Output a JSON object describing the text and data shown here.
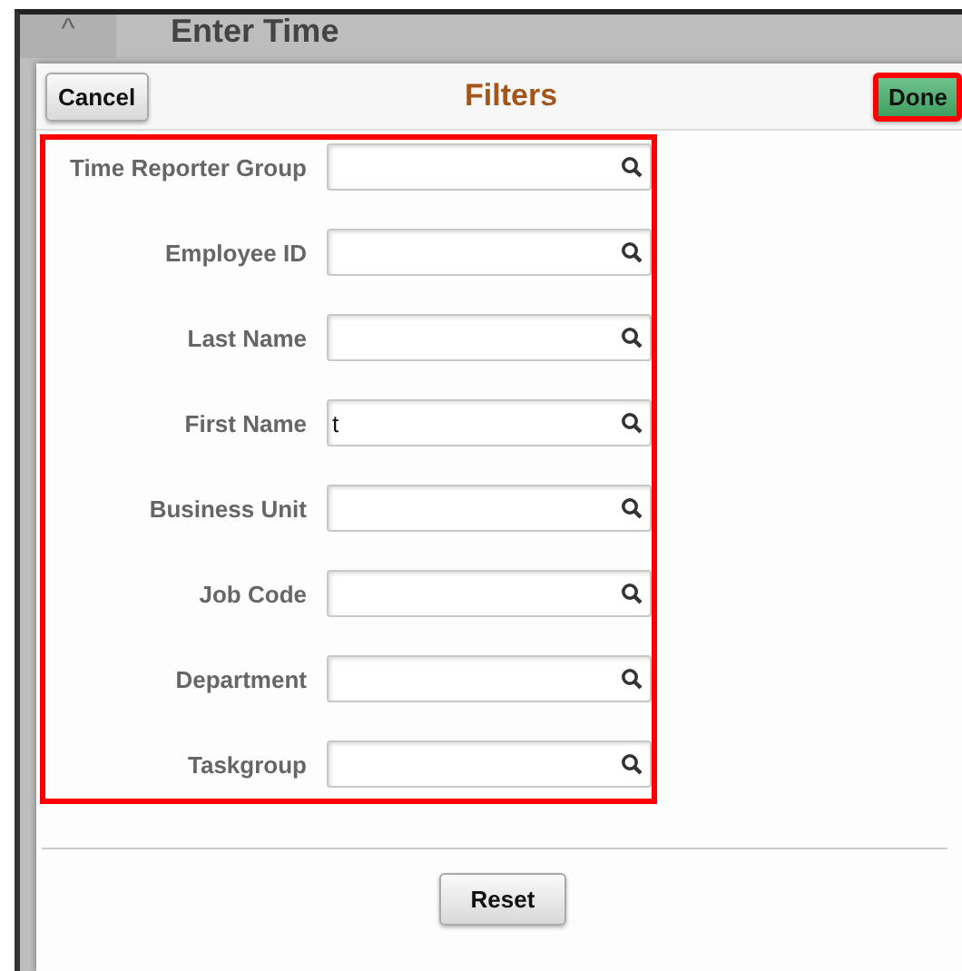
{
  "page": {
    "title": "Enter Time",
    "collapse_icon": "^"
  },
  "dialog": {
    "title": "Filters",
    "cancel": "Cancel",
    "done": "Done",
    "fields": [
      {
        "label": "Time Reporter Group"
      },
      {
        "label": "Employee ID"
      },
      {
        "label": "Last Name"
      },
      {
        "label": "First Name",
        "value": "t"
      },
      {
        "label": "Business Unit"
      },
      {
        "label": "Job Code"
      },
      {
        "label": "Department"
      },
      {
        "label": "Taskgroup"
      }
    ],
    "reset": "Reset"
  }
}
